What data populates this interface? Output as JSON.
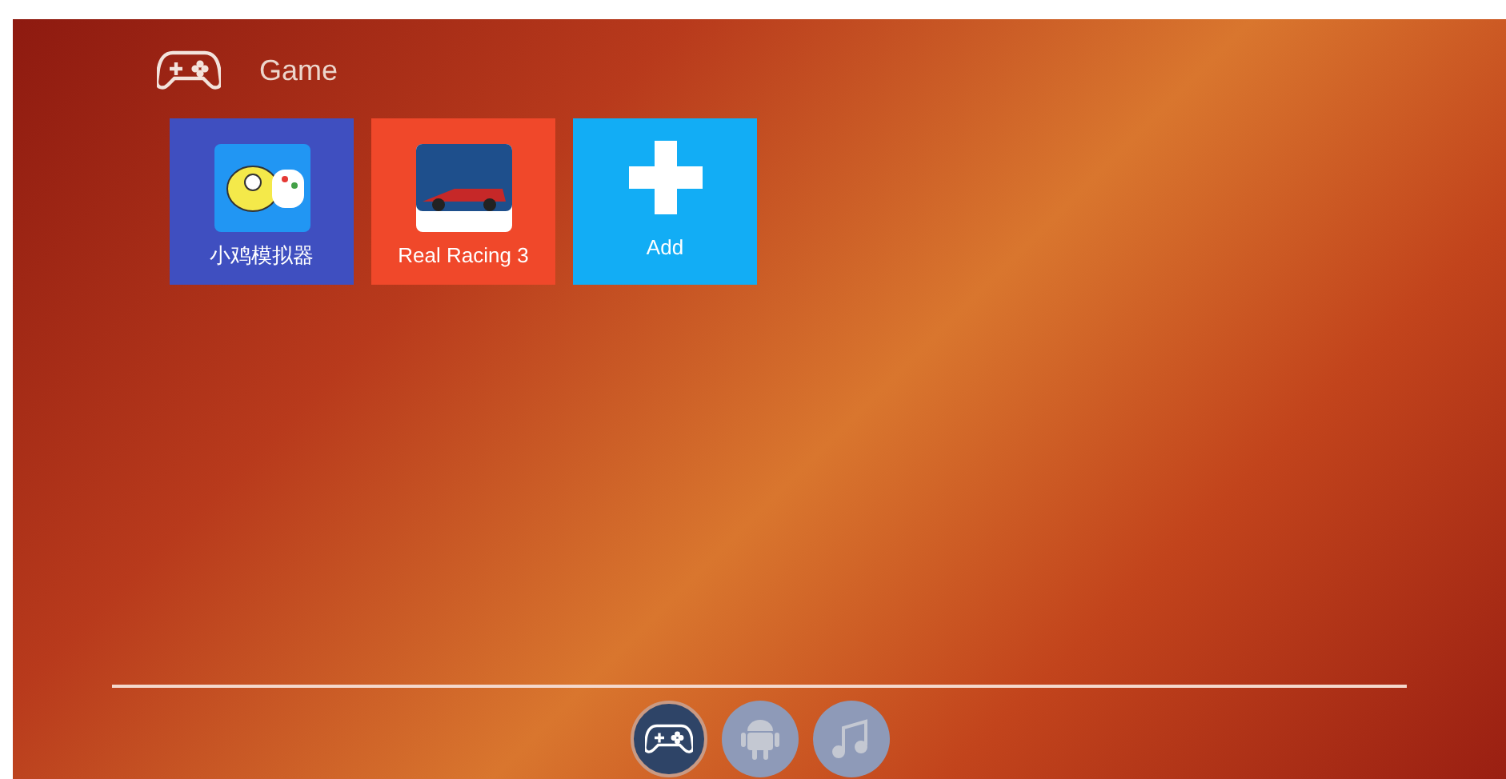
{
  "section": {
    "title": "Game"
  },
  "tiles": [
    {
      "kind": "app",
      "label": "小鸡模拟器",
      "color": "#3f4fc0"
    },
    {
      "kind": "app",
      "label": "Real Racing 3",
      "color": "#f0482a"
    },
    {
      "kind": "add",
      "label": "Add",
      "color": "#12adf5"
    }
  ],
  "dock": [
    {
      "kind": "gamepad",
      "selected": true
    },
    {
      "kind": "android",
      "selected": false
    },
    {
      "kind": "music",
      "selected": false
    }
  ]
}
